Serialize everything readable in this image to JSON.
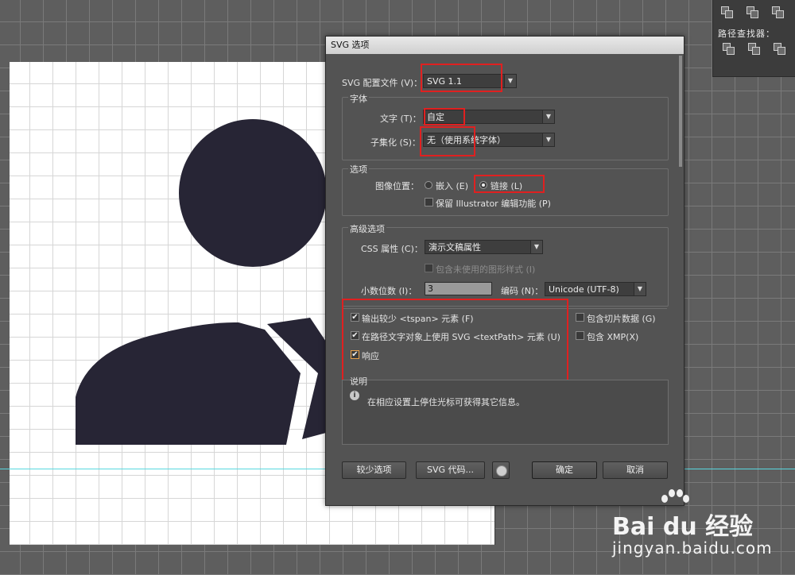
{
  "pathfinder": {
    "title": "路径查找器："
  },
  "dialog": {
    "title": "SVG 选项",
    "profile": {
      "label": "SVG 配置文件 (V)：",
      "value": "SVG 1.1"
    },
    "font_group": {
      "title": "字体",
      "type_label": "文字 (T)：",
      "type_value": "自定",
      "subset_label": "子集化 (S)：",
      "subset_value": "无（使用系统字体）"
    },
    "options_group": {
      "title": "选项",
      "image_location_label": "图像位置：",
      "embed_label": "嵌入 (E)",
      "link_label": "链接 (L)",
      "preserve_label": "保留 Illustrator 编辑功能 (P)"
    },
    "advanced_group": {
      "title": "高级选项",
      "css_label": "CSS 属性 (C)：",
      "css_value": "演示文稿属性",
      "unused_styles_label": "包含未使用的图形样式 (I)",
      "decimal_label": "小数位数 (I)：",
      "decimal_value": "3",
      "encoding_label": "编码 (N)：",
      "encoding_value": "Unicode (UTF-8)",
      "tspan_label": "输出较少 <tspan> 元素 (F)",
      "textpath_label": "在路径文字对象上使用 SVG <textPath> 元素 (U)",
      "responsive_label": "响应",
      "slice_label": "包含切片数据 (G)",
      "xmp_label": "包含 XMP(X)"
    },
    "description": {
      "title": "说明",
      "text": "在相应设置上停住光标可获得其它信息。"
    },
    "buttons": {
      "fewer_options": "较少选项",
      "svg_code": "SVG 代码...",
      "ok": "确定",
      "cancel": "取消"
    }
  },
  "watermark": {
    "logo": "Bai du 经验",
    "url": "jingyan.baidu.com"
  },
  "colors": {
    "figure": "#272535",
    "highlight": "#e02020",
    "guide": "#58d8e0"
  }
}
